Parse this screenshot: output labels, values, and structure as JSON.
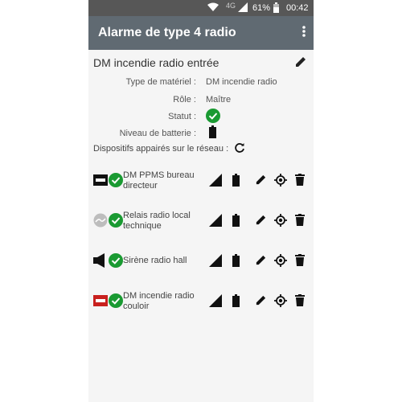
{
  "statusbar": {
    "network": "4G",
    "battery_pct": "61%",
    "time": "00:42"
  },
  "appbar": {
    "title": "Alarme de type 4 radio"
  },
  "device": {
    "title": "DM incendie radio entrée",
    "type_label": "Type de matériel :",
    "type_value": "DM incendie radio",
    "role_label": "Rôle :",
    "role_value": "Maître",
    "status_label": "Statut :",
    "battery_label": "Niveau de batterie :"
  },
  "paired": {
    "label": "Dispositifs appairés sur le réseau :",
    "items": [
      {
        "name": "DM PPMS bureau directeur",
        "icon": "call-point-black-icon"
      },
      {
        "name": "Relais radio local technique",
        "icon": "relay-grey-icon"
      },
      {
        "name": "Sirène radio hall",
        "icon": "siren-speaker-icon"
      },
      {
        "name": "DM incendie radio couloir",
        "icon": "call-point-red-icon"
      }
    ]
  },
  "colors": {
    "appbar": "#606a72",
    "statusbar": "#575757",
    "ok_green": "#1a9a32",
    "alarm_red": "#c8201e"
  }
}
